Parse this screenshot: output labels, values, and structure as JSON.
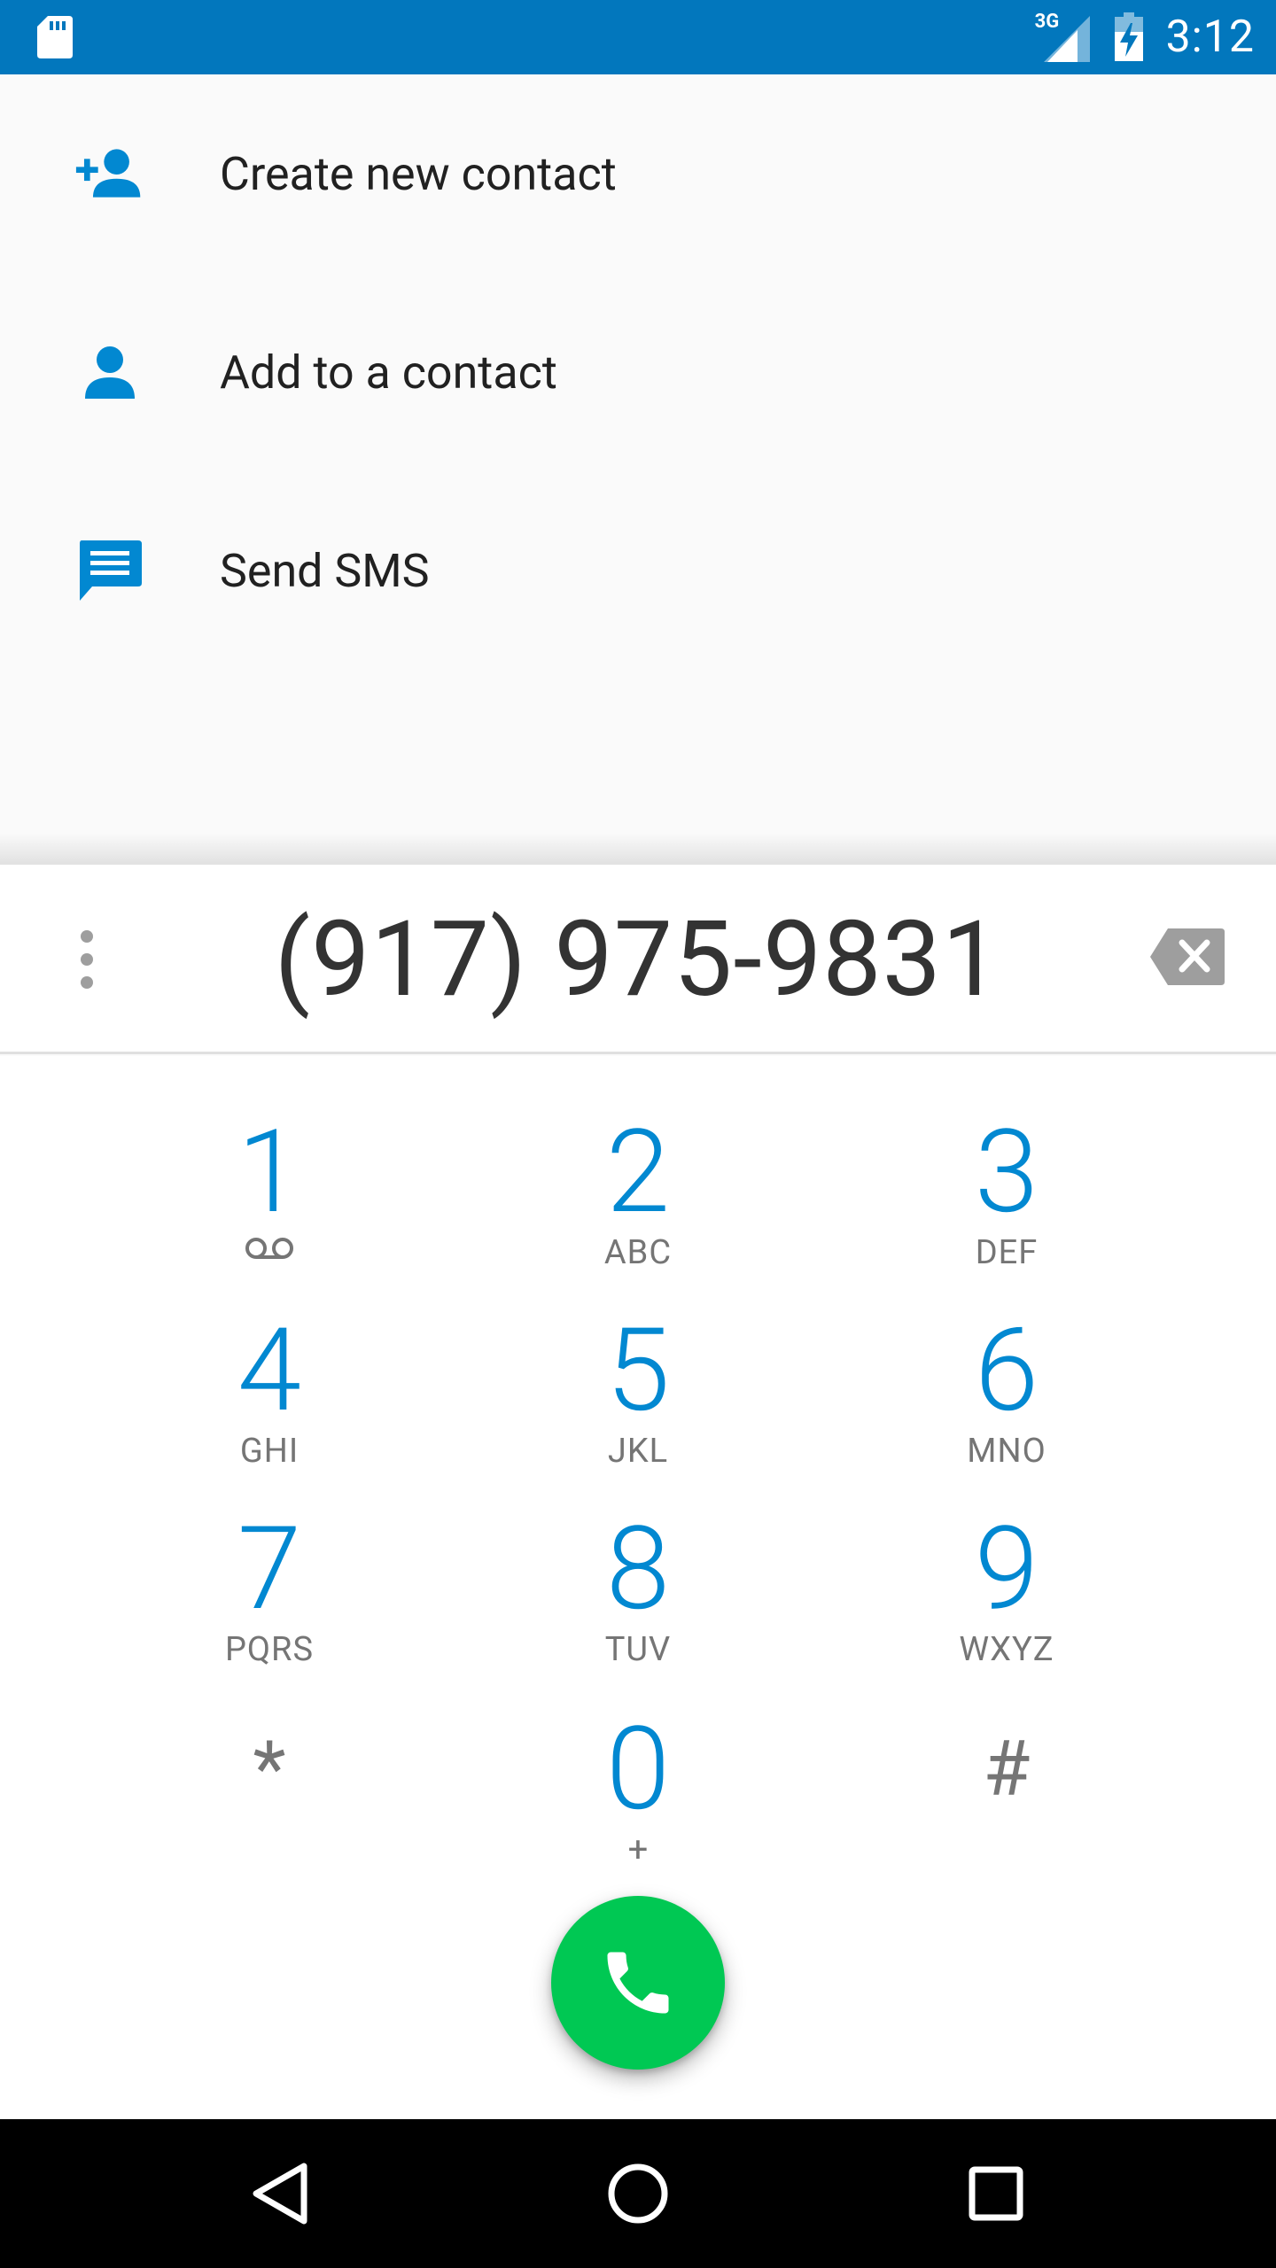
{
  "status_bar": {
    "network_label": "3G",
    "time": "3:12",
    "icons": [
      "sd-card-icon",
      "signal-icon",
      "battery-charging-icon"
    ]
  },
  "actions": [
    {
      "label": "Create new contact",
      "icon": "add-person-icon"
    },
    {
      "label": "Add to a contact",
      "icon": "person-icon"
    },
    {
      "label": "Send SMS",
      "icon": "message-icon"
    }
  ],
  "dialer": {
    "number": "(917) 975-9831",
    "keys": [
      {
        "digit": "1",
        "letters": ""
      },
      {
        "digit": "2",
        "letters": "ABC"
      },
      {
        "digit": "3",
        "letters": "DEF"
      },
      {
        "digit": "4",
        "letters": "GHI"
      },
      {
        "digit": "5",
        "letters": "JKL"
      },
      {
        "digit": "6",
        "letters": "MNO"
      },
      {
        "digit": "7",
        "letters": "PQRS"
      },
      {
        "digit": "8",
        "letters": "TUV"
      },
      {
        "digit": "9",
        "letters": "WXYZ"
      },
      {
        "digit": "*",
        "letters": ""
      },
      {
        "digit": "0",
        "letters": "+"
      },
      {
        "digit": "#",
        "letters": ""
      }
    ]
  },
  "colors": {
    "status_bar": "#0277bd",
    "accent": "#0288d1",
    "call_button": "#00c853"
  }
}
